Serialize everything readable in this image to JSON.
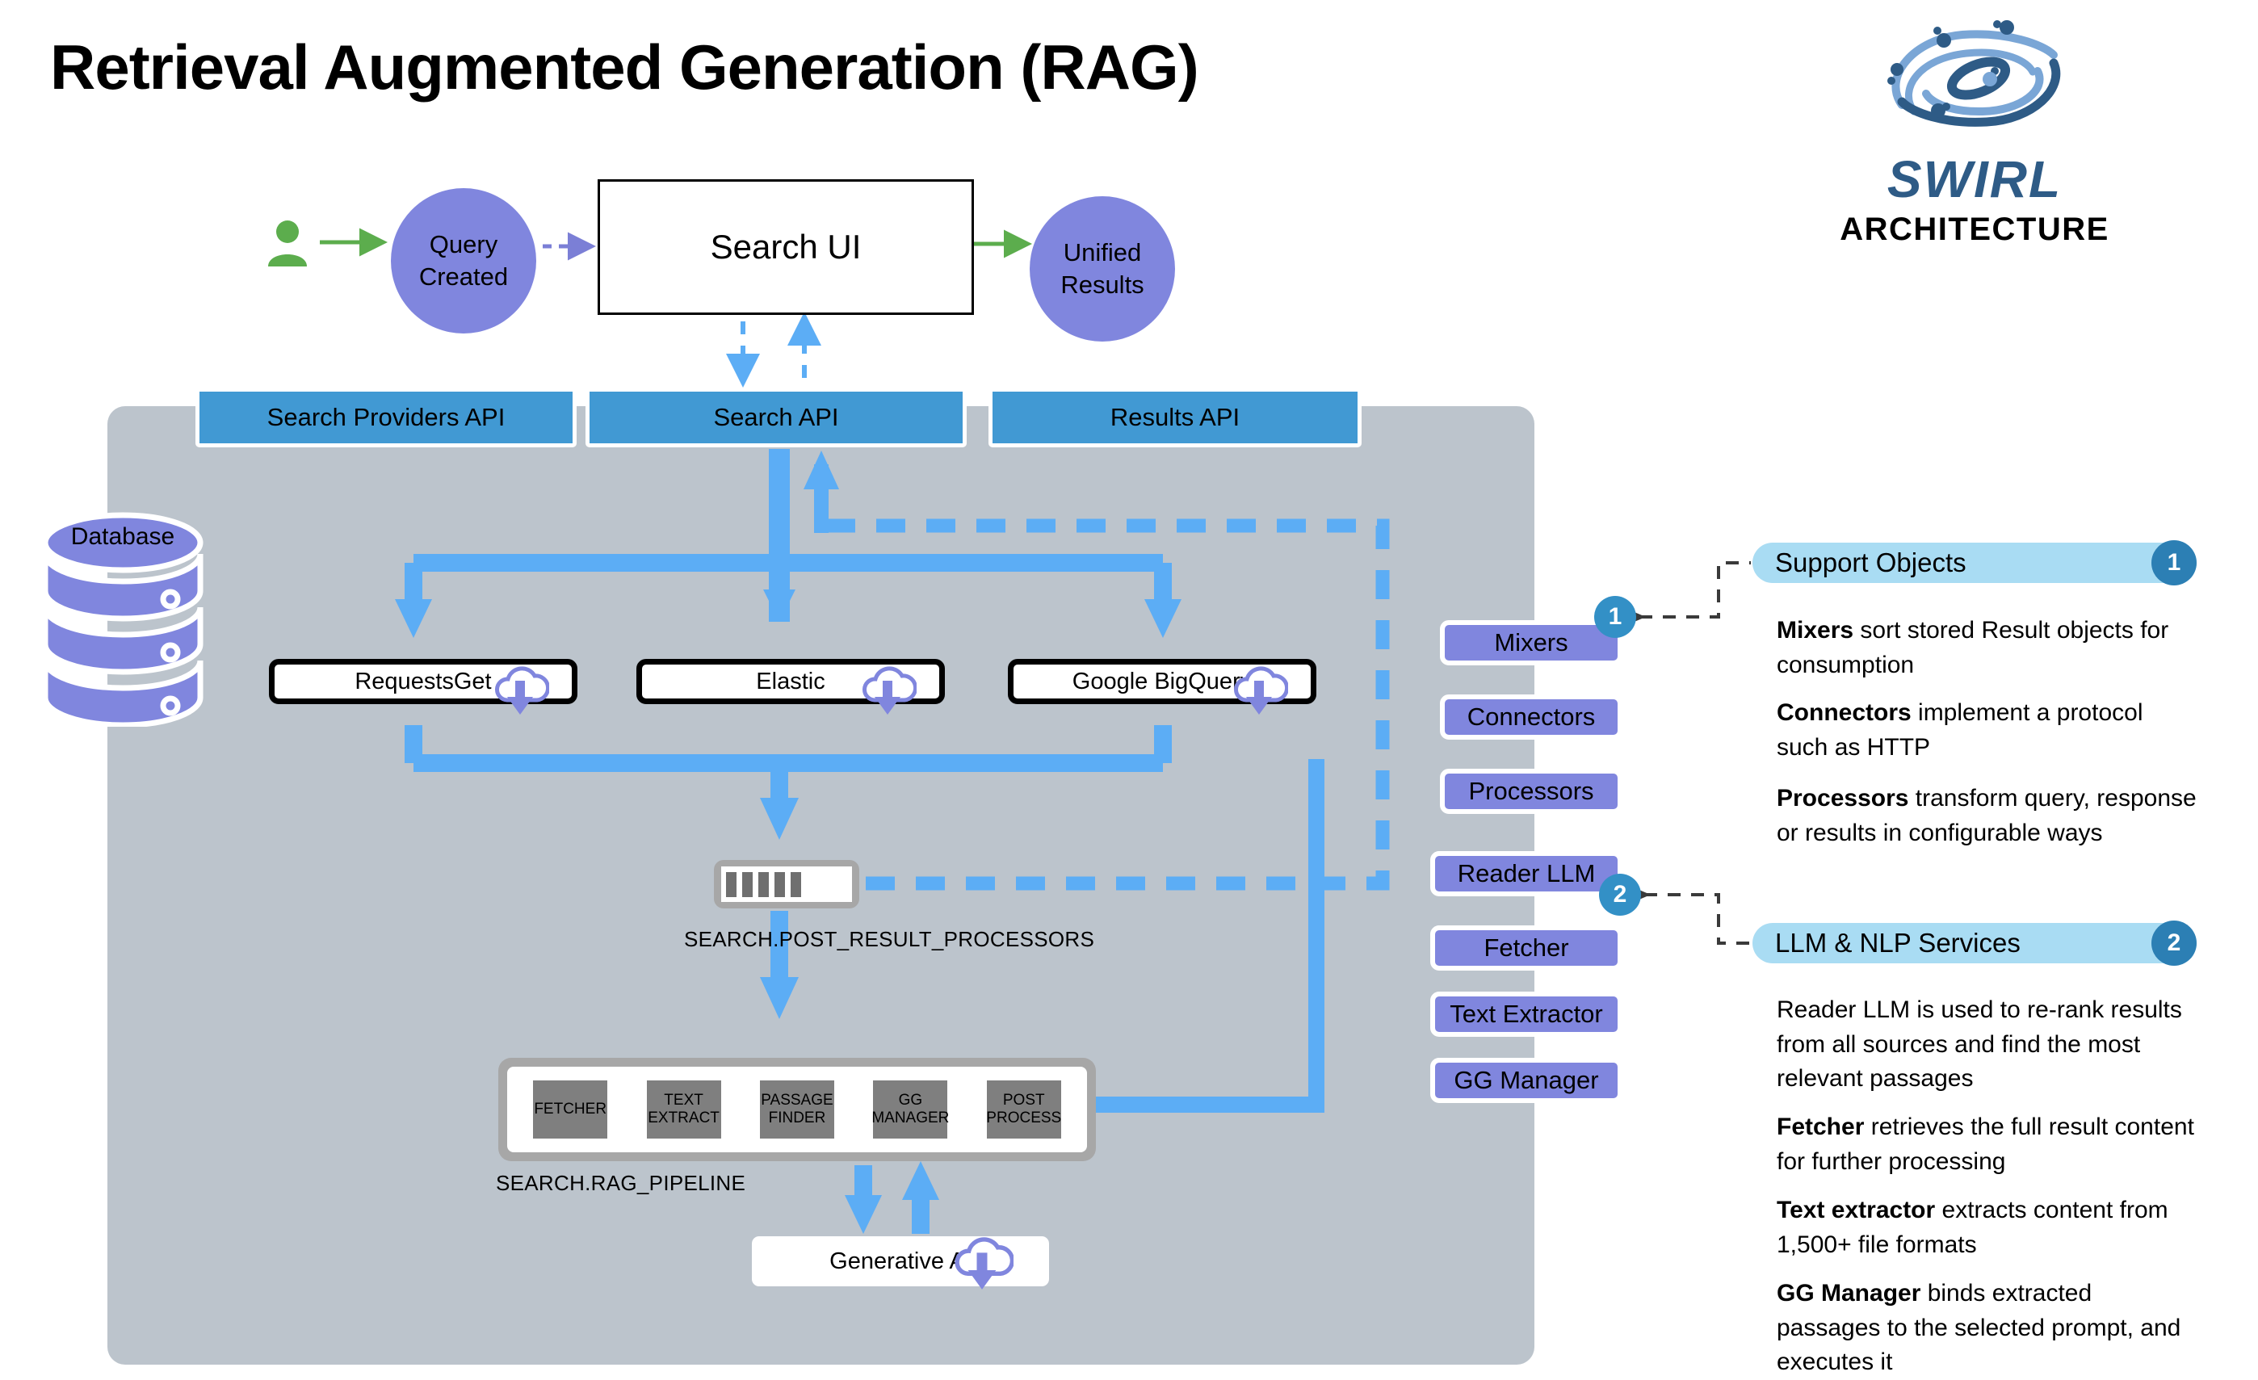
{
  "title": "Retrieval Augmented Generation (RAG)",
  "logo": {
    "wordmark": "SWIRL",
    "subtitle": "ARCHITECTURE"
  },
  "colors": {
    "api_bar": "#4199d3",
    "panel_gray": "#bcc4cc",
    "purple": "#8086de",
    "arrow_blue": "#5cadf5",
    "green": "#5cad4d",
    "section_header": "#a9dcf3",
    "badge": "#3390c6"
  },
  "flow": {
    "user_icon": "person-icon",
    "query_created": "Query\nCreated",
    "query_created_l1": "Query",
    "query_created_l2": "Created",
    "search_ui": "Search UI",
    "unified_results_l1": "Unified",
    "unified_results_l2": "Results"
  },
  "api_bars": [
    {
      "label": "Search Providers API"
    },
    {
      "label": "Search API"
    },
    {
      "label": "Results API"
    }
  ],
  "database": {
    "label": "Database"
  },
  "providers": [
    {
      "label": "RequestsGet",
      "icon": "cloud-download-icon"
    },
    {
      "label": "Elastic",
      "icon": "cloud-download-icon"
    },
    {
      "label": "Google BigQuery",
      "icon": "cloud-download-icon"
    }
  ],
  "post_result_processors": {
    "caption": "SEARCH.POST_RESULT_PROCESSORS",
    "bars": 5
  },
  "rag_pipeline": {
    "caption": "SEARCH.RAG_PIPELINE",
    "steps": [
      {
        "l1": "FETCHER",
        "l2": ""
      },
      {
        "l1": "TEXT",
        "l2": "EXTRACT"
      },
      {
        "l1": "PASSAGE",
        "l2": "FINDER"
      },
      {
        "l1": "GG",
        "l2": "MANAGER"
      },
      {
        "l1": "POST",
        "l2": "PROCESS"
      }
    ]
  },
  "generative_ai": {
    "label": "Generative AI",
    "icon": "cloud-download-icon"
  },
  "components": [
    {
      "label": "Mixers",
      "stacked": true
    },
    {
      "label": "Connectors",
      "stacked": true
    },
    {
      "label": "Processors",
      "stacked": true
    },
    {
      "label": "Reader LLM",
      "stacked": false
    },
    {
      "label": "Fetcher",
      "stacked": false
    },
    {
      "label": "Text Extractor",
      "stacked": false
    },
    {
      "label": "GG Manager",
      "stacked": false
    }
  ],
  "badges": {
    "a": "1",
    "b": "2"
  },
  "sections": [
    {
      "header": "Support Objects",
      "number": "1",
      "paragraphs": [
        {
          "bold": "Mixers",
          "rest": " sort stored Result objects for consumption"
        },
        {
          "bold": "Connectors",
          "rest": " implement a protocol such as HTTP"
        },
        {
          "bold": "Processors",
          "rest": " transform query, response or results in configurable ways"
        }
      ]
    },
    {
      "header": "LLM & NLP Services",
      "number": "2",
      "paragraphs": [
        {
          "bold": "",
          "rest": "Reader LLM is used to re-rank results from all sources and find  the most relevant passages"
        },
        {
          "bold": "Fetcher",
          "rest": " retrieves the full result content for further processing"
        },
        {
          "bold": "Text extractor",
          "rest": " extracts content from 1,500+ file formats"
        },
        {
          "bold": "GG Manager",
          "rest": " binds extracted passages to the selected prompt, and executes it"
        }
      ]
    }
  ]
}
